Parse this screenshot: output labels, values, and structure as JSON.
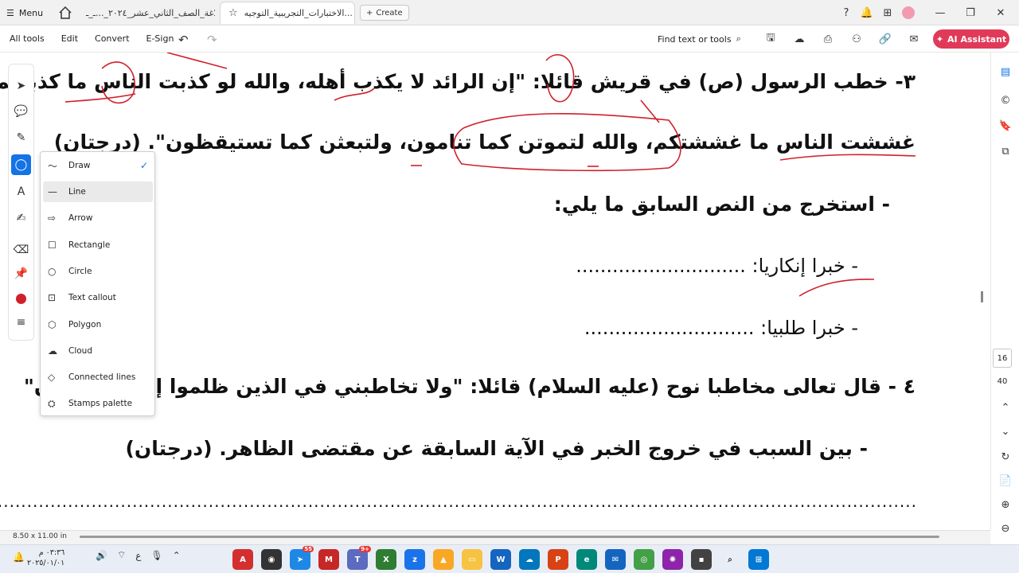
{
  "tabbar": {
    "menu_label": "Menu",
    "tab1_label": "بلاغة_الصف_الثاني_عشر_٢٠٢٤_...ـ_ـ",
    "tab2_label": "الاختبارات_التجريبية_التوجيه...",
    "create_label": "Create"
  },
  "toolbar": {
    "all_tools": "All tools",
    "edit": "Edit",
    "convert": "Convert",
    "esign": "E-Sign",
    "find": "Find text or tools",
    "ai_assistant": "AI Assistant"
  },
  "document": {
    "q3_line1": "٣- خطب الرسول (ص) في قريش قائلا: \"إن الرائد لا يكذب أهله، والله لو كذبت الناس ما كذبتكم، ولو",
    "q3_line2": "غششت الناس ما غششتكم، والله لتموتن كما تنامون، ولتبعثن كما تستيقظون\". (درجتان)",
    "extract": "- استخرج من النص السابق ما يلي:",
    "item1": "- خبرا إنكاريا: ............................",
    "item2": "- خبرا طلبيا: ............................",
    "q4_line1": "٤ - قال تعالى مخاطبا نوح (عليه السلام) قائلا: \"ولا تخاطبني في الذين ظلموا إنهم مغرقون\"",
    "q4_line2": "- بين السبب في خروج الخبر في الآية السابقة عن مقتضى الظاهر. (درجتان)",
    "dots": "......................................................................................................................................................................"
  },
  "dropdown": {
    "items": [
      {
        "label": "Draw",
        "icon": "draw-icon",
        "checked": true
      },
      {
        "label": "Line",
        "icon": "line-icon",
        "selected": true
      },
      {
        "label": "Arrow",
        "icon": "arrow-icon"
      },
      {
        "label": "Rectangle",
        "icon": "rectangle-icon"
      },
      {
        "label": "Circle",
        "icon": "circle-icon"
      },
      {
        "label": "Text callout",
        "icon": "text-callout-icon"
      },
      {
        "label": "Polygon",
        "icon": "polygon-icon"
      },
      {
        "label": "Cloud",
        "icon": "cloud-icon"
      },
      {
        "label": "Connected lines",
        "icon": "connected-lines-icon"
      },
      {
        "label": "Stamps palette",
        "icon": "stamps-palette-icon"
      }
    ]
  },
  "status": {
    "page_size": "8.50 x 11.00 in",
    "current_page": "16",
    "total_pages": "40"
  },
  "taskbar": {
    "time": "٠٣:٣٦ م",
    "date": "٢٠٢٥/٠١/٠١",
    "lang": "ع",
    "badge1": "55",
    "badge2": "9+"
  },
  "colors": {
    "accent": "#1473e6",
    "ai": "#e03a58",
    "annotation": "#d0202a"
  }
}
